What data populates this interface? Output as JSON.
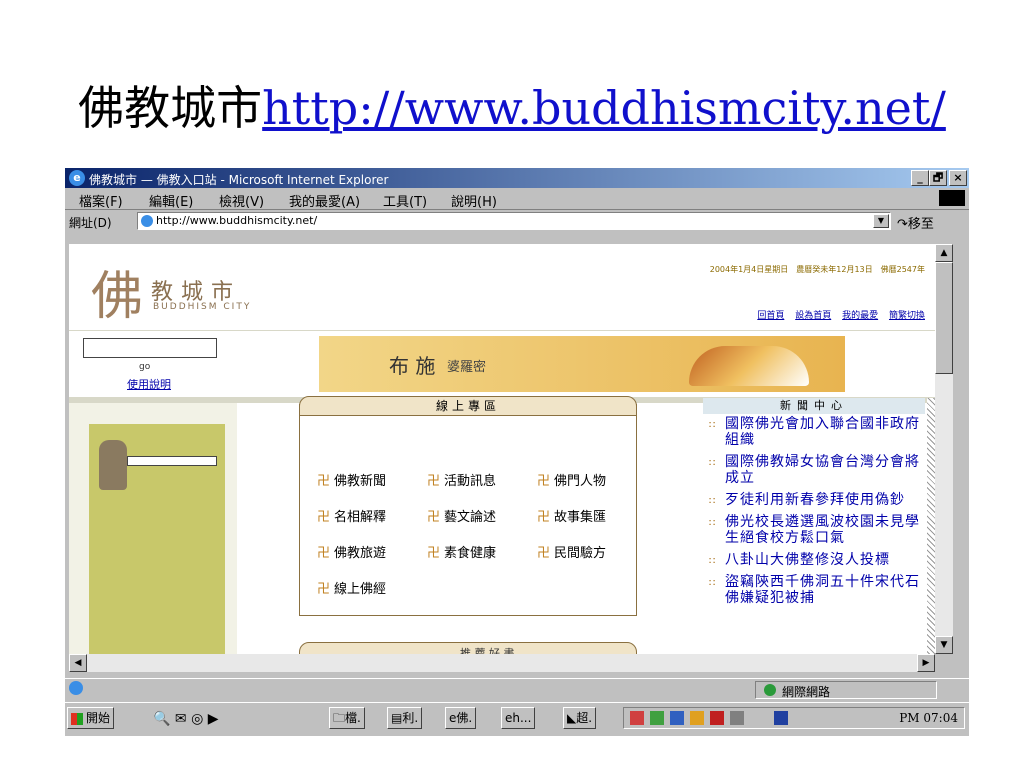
{
  "slide": {
    "title_cn": "佛教城市",
    "title_url": "http://www.buddhismcity.net/"
  },
  "window": {
    "title": "佛教城市 — 佛教入口站 - Microsoft Internet Explorer",
    "controls": [
      "_",
      "🗗",
      "×"
    ]
  },
  "menu": [
    "檔案(F)",
    "編輯(E)",
    "檢視(V)",
    "我的最愛(A)",
    "工具(T)",
    "說明(H)"
  ],
  "address": {
    "label": "網址(D)",
    "url": "http://www.buddhismcity.net/",
    "go_label": "移至"
  },
  "page": {
    "logo_char": "佛",
    "logo_name": "教城市",
    "logo_en": "BUDDHISM CITY",
    "date_line": "2004年1月4日星期日　農曆癸未年12月13日　佛曆2547年",
    "top_links": [
      "回首頁",
      "設為首頁",
      "我的最愛",
      "簡繁切換"
    ],
    "search_go": "go",
    "help_label": "使用說明",
    "banner_main": "布 施",
    "banner_sub": "婆羅密",
    "zone": {
      "title": "線上專區",
      "items": [
        "佛教新聞",
        "活動訊息",
        "佛門人物",
        "名相解釋",
        "藝文論述",
        "故事集匯",
        "佛教旅遊",
        "素食健康",
        "民間驗方",
        "線上佛經"
      ],
      "swastika": "卍"
    },
    "zone_foot": "推 薦 好 書",
    "news": {
      "title": "新聞中心",
      "bullet": "∷",
      "items": [
        "國際佛光會加入聯合國非政府組織",
        "國際佛教婦女協會台灣分會將成立",
        "歹徒利用新春參拜使用偽鈔",
        "佛光校長遴選風波校園未見學生絕食校方鬆口氣",
        "八卦山大佛整修沒人投標",
        "盜竊陝西千佛洞五十件宋代石佛嫌疑犯被捕"
      ]
    }
  },
  "status": {
    "zone": "網際網路"
  },
  "taskbar": {
    "start": "開始",
    "tasks": [
      "檔.",
      "利.",
      "佛.",
      "h...",
      "超."
    ],
    "clock": "PM 07:04"
  },
  "colors": {
    "title_bar": "#0a246a",
    "link": "#0000aa",
    "olive": "#c8c86a"
  }
}
